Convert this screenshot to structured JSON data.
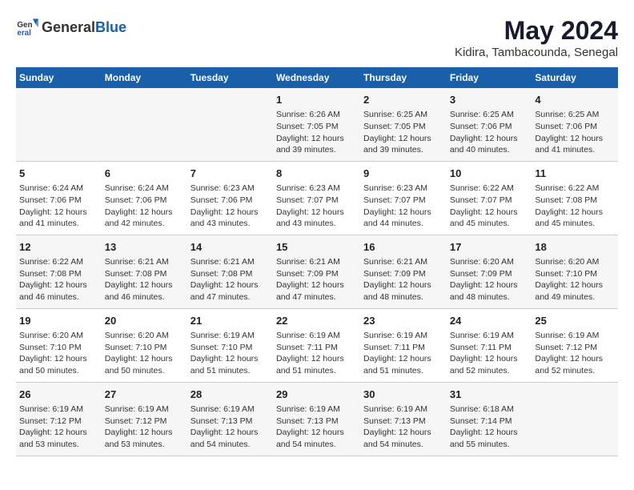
{
  "header": {
    "logo_general": "General",
    "logo_blue": "Blue",
    "title": "May 2024",
    "subtitle": "Kidira, Tambacounda, Senegal"
  },
  "days_of_week": [
    "Sunday",
    "Monday",
    "Tuesday",
    "Wednesday",
    "Thursday",
    "Friday",
    "Saturday"
  ],
  "weeks": [
    [
      {
        "day": "",
        "info": ""
      },
      {
        "day": "",
        "info": ""
      },
      {
        "day": "",
        "info": ""
      },
      {
        "day": "1",
        "info": "Sunrise: 6:26 AM\nSunset: 7:05 PM\nDaylight: 12 hours\nand 39 minutes."
      },
      {
        "day": "2",
        "info": "Sunrise: 6:25 AM\nSunset: 7:05 PM\nDaylight: 12 hours\nand 39 minutes."
      },
      {
        "day": "3",
        "info": "Sunrise: 6:25 AM\nSunset: 7:06 PM\nDaylight: 12 hours\nand 40 minutes."
      },
      {
        "day": "4",
        "info": "Sunrise: 6:25 AM\nSunset: 7:06 PM\nDaylight: 12 hours\nand 41 minutes."
      }
    ],
    [
      {
        "day": "5",
        "info": "Sunrise: 6:24 AM\nSunset: 7:06 PM\nDaylight: 12 hours\nand 41 minutes."
      },
      {
        "day": "6",
        "info": "Sunrise: 6:24 AM\nSunset: 7:06 PM\nDaylight: 12 hours\nand 42 minutes."
      },
      {
        "day": "7",
        "info": "Sunrise: 6:23 AM\nSunset: 7:06 PM\nDaylight: 12 hours\nand 43 minutes."
      },
      {
        "day": "8",
        "info": "Sunrise: 6:23 AM\nSunset: 7:07 PM\nDaylight: 12 hours\nand 43 minutes."
      },
      {
        "day": "9",
        "info": "Sunrise: 6:23 AM\nSunset: 7:07 PM\nDaylight: 12 hours\nand 44 minutes."
      },
      {
        "day": "10",
        "info": "Sunrise: 6:22 AM\nSunset: 7:07 PM\nDaylight: 12 hours\nand 45 minutes."
      },
      {
        "day": "11",
        "info": "Sunrise: 6:22 AM\nSunset: 7:08 PM\nDaylight: 12 hours\nand 45 minutes."
      }
    ],
    [
      {
        "day": "12",
        "info": "Sunrise: 6:22 AM\nSunset: 7:08 PM\nDaylight: 12 hours\nand 46 minutes."
      },
      {
        "day": "13",
        "info": "Sunrise: 6:21 AM\nSunset: 7:08 PM\nDaylight: 12 hours\nand 46 minutes."
      },
      {
        "day": "14",
        "info": "Sunrise: 6:21 AM\nSunset: 7:08 PM\nDaylight: 12 hours\nand 47 minutes."
      },
      {
        "day": "15",
        "info": "Sunrise: 6:21 AM\nSunset: 7:09 PM\nDaylight: 12 hours\nand 47 minutes."
      },
      {
        "day": "16",
        "info": "Sunrise: 6:21 AM\nSunset: 7:09 PM\nDaylight: 12 hours\nand 48 minutes."
      },
      {
        "day": "17",
        "info": "Sunrise: 6:20 AM\nSunset: 7:09 PM\nDaylight: 12 hours\nand 48 minutes."
      },
      {
        "day": "18",
        "info": "Sunrise: 6:20 AM\nSunset: 7:10 PM\nDaylight: 12 hours\nand 49 minutes."
      }
    ],
    [
      {
        "day": "19",
        "info": "Sunrise: 6:20 AM\nSunset: 7:10 PM\nDaylight: 12 hours\nand 50 minutes."
      },
      {
        "day": "20",
        "info": "Sunrise: 6:20 AM\nSunset: 7:10 PM\nDaylight: 12 hours\nand 50 minutes."
      },
      {
        "day": "21",
        "info": "Sunrise: 6:19 AM\nSunset: 7:10 PM\nDaylight: 12 hours\nand 51 minutes."
      },
      {
        "day": "22",
        "info": "Sunrise: 6:19 AM\nSunset: 7:11 PM\nDaylight: 12 hours\nand 51 minutes."
      },
      {
        "day": "23",
        "info": "Sunrise: 6:19 AM\nSunset: 7:11 PM\nDaylight: 12 hours\nand 51 minutes."
      },
      {
        "day": "24",
        "info": "Sunrise: 6:19 AM\nSunset: 7:11 PM\nDaylight: 12 hours\nand 52 minutes."
      },
      {
        "day": "25",
        "info": "Sunrise: 6:19 AM\nSunset: 7:12 PM\nDaylight: 12 hours\nand 52 minutes."
      }
    ],
    [
      {
        "day": "26",
        "info": "Sunrise: 6:19 AM\nSunset: 7:12 PM\nDaylight: 12 hours\nand 53 minutes."
      },
      {
        "day": "27",
        "info": "Sunrise: 6:19 AM\nSunset: 7:12 PM\nDaylight: 12 hours\nand 53 minutes."
      },
      {
        "day": "28",
        "info": "Sunrise: 6:19 AM\nSunset: 7:13 PM\nDaylight: 12 hours\nand 54 minutes."
      },
      {
        "day": "29",
        "info": "Sunrise: 6:19 AM\nSunset: 7:13 PM\nDaylight: 12 hours\nand 54 minutes."
      },
      {
        "day": "30",
        "info": "Sunrise: 6:19 AM\nSunset: 7:13 PM\nDaylight: 12 hours\nand 54 minutes."
      },
      {
        "day": "31",
        "info": "Sunrise: 6:18 AM\nSunset: 7:14 PM\nDaylight: 12 hours\nand 55 minutes."
      },
      {
        "day": "",
        "info": ""
      }
    ]
  ]
}
